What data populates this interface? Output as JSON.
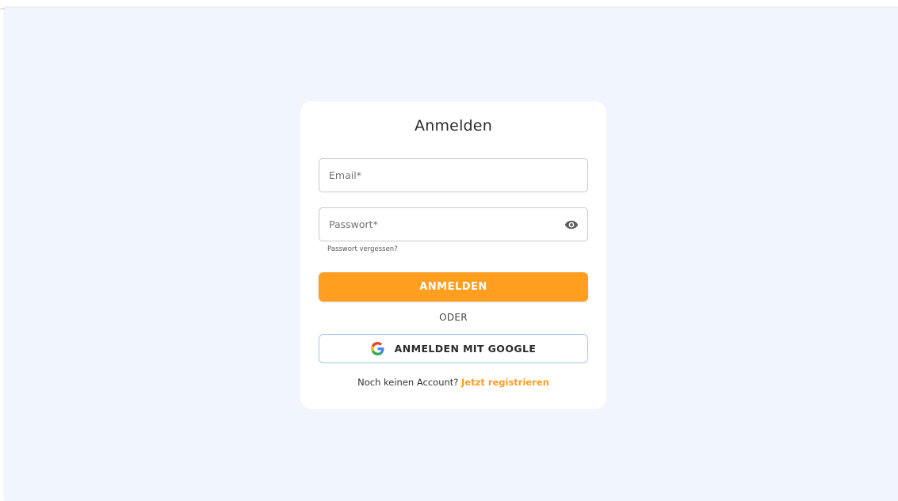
{
  "login": {
    "title": "Anmelden",
    "email_placeholder": "Email",
    "password_placeholder": "Passwort",
    "required_marker": "*",
    "forgot_password": "Passwort vergessen?",
    "submit_label": "ANMELDEN",
    "divider": "ODER",
    "google_label": "ANMELDEN MIT GOOGLE",
    "no_account_text": "Noch keinen Account?",
    "register_link": "Jetzt registrieren"
  },
  "colors": {
    "accent": "#ff9e1f",
    "page_background": "#f1f5fd",
    "card_background": "#ffffff",
    "google_border": "#a9c7e8"
  },
  "icons": {
    "password_toggle": "eye-icon",
    "google": "google-logo-icon"
  }
}
